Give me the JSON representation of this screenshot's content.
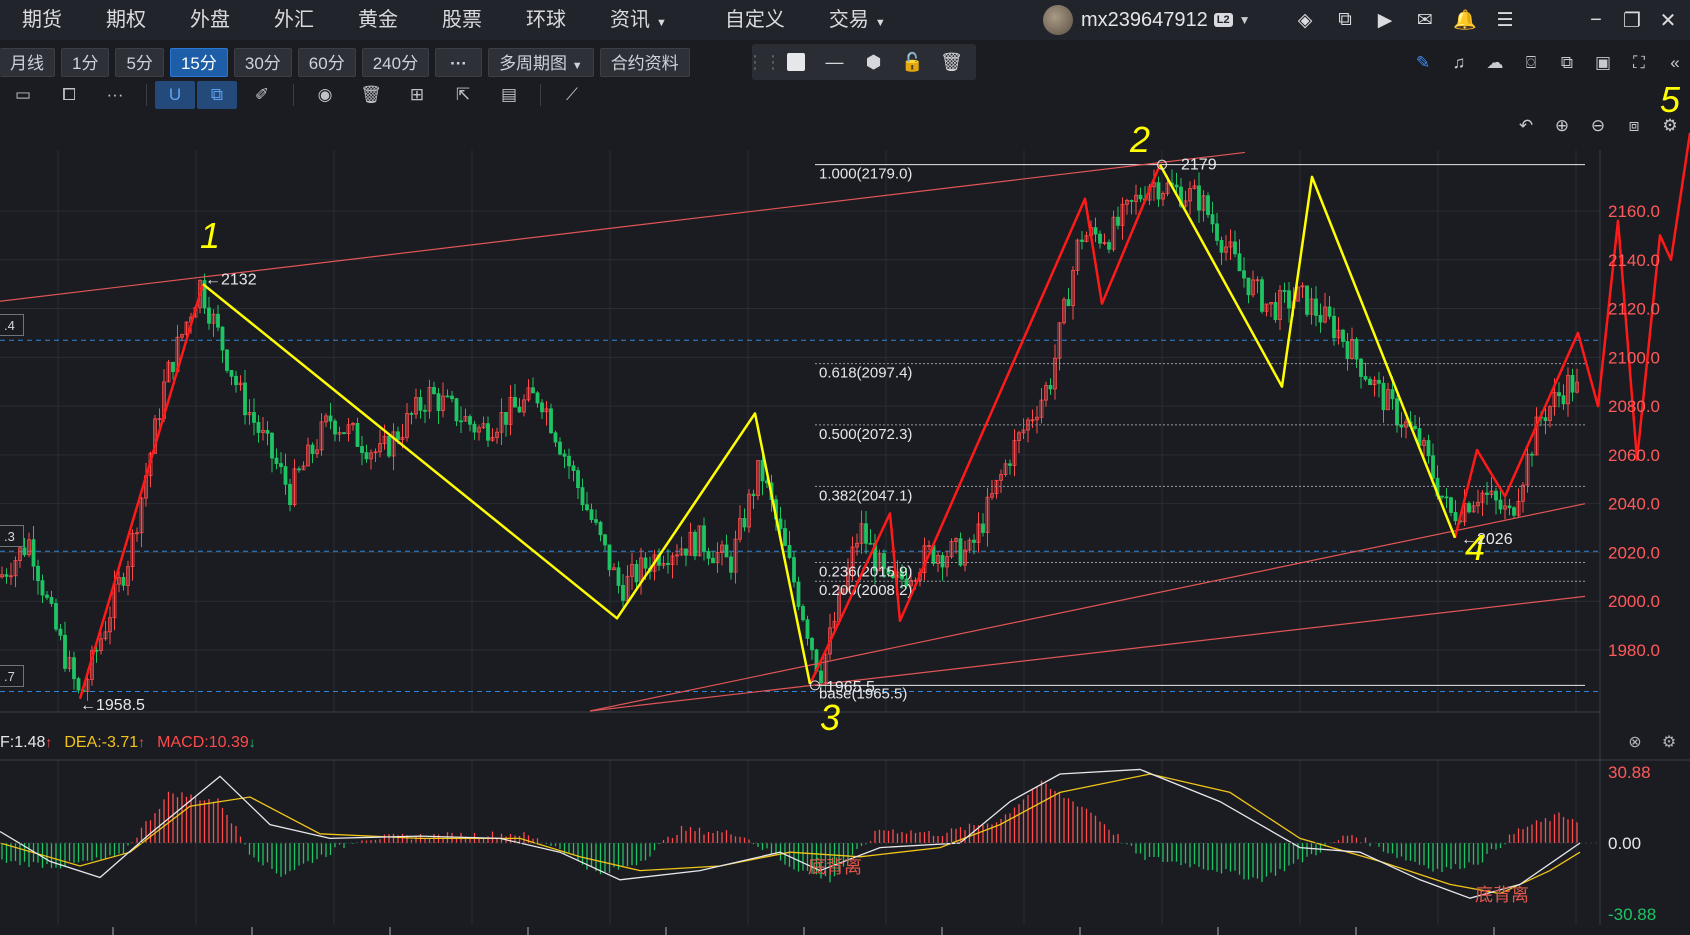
{
  "top_nav": {
    "items": [
      {
        "label": "期货",
        "dropdown": false
      },
      {
        "label": "期权",
        "dropdown": false
      },
      {
        "label": "外盘",
        "dropdown": false
      },
      {
        "label": "外汇",
        "dropdown": false
      },
      {
        "label": "黄金",
        "dropdown": false
      },
      {
        "label": "股票",
        "dropdown": false
      },
      {
        "label": "环球",
        "dropdown": false
      },
      {
        "label": "资讯",
        "dropdown": true
      },
      {
        "label": "自定义",
        "dropdown": false
      },
      {
        "label": "交易",
        "dropdown": true
      }
    ]
  },
  "user": {
    "name": "mx239647912",
    "badge": "L2"
  },
  "top_icons": [
    "layers-icon",
    "expand-window-icon",
    "video-icon",
    "mail-icon",
    "bell-icon",
    "menu-list-icon"
  ],
  "window_buttons": {
    "minimize": "−",
    "restore": "❐",
    "close": "✕"
  },
  "period_toolbar": {
    "buttons": [
      "月线",
      "1分",
      "5分",
      "15分",
      "30分",
      "60分",
      "240分",
      "···",
      "多周期图",
      "合约资料"
    ],
    "active": "15分"
  },
  "draw_toolbar": [
    "grip-icon",
    "square-icon",
    "line-icon",
    "hexagon-icon",
    "unlock-icon",
    "trash-icon"
  ],
  "right_toolbar": [
    "pen-icon",
    "alert-icon",
    "cloud-icon",
    "camera-icon",
    "copy-icon",
    "monitor-icon",
    "fullscreen-icon",
    "collapse-icon"
  ],
  "secondary_toolbar": [
    "comment-icon",
    "crop-icon",
    "more-icon",
    "magnet-icon",
    "overlap-icon",
    "pencil-icon",
    "eye-icon",
    "delete-icon",
    "grid-icon",
    "share-icon",
    "note-icon",
    "ruler-icon"
  ],
  "chart_controls": [
    "undo-icon",
    "zoom-in-icon",
    "zoom-out-icon",
    "fit-icon",
    "settings-icon"
  ],
  "colors": {
    "background": "#1b1c21",
    "up_candle": "#ff4b4b",
    "down_candle": "#1ec463",
    "wave_red": "#ff1a1a",
    "wave_yellow": "#ffff00",
    "trend_line": "#e05555",
    "dashed_blue": "#2f86d6",
    "axis_text": "#ff5a5a"
  },
  "price_axis_labels": [
    "2160.0",
    "2140.0",
    "2120.0",
    "2100.0",
    "2080.0",
    "2060.0",
    "2040.0",
    "2020.0",
    "2000.0",
    "1980.0"
  ],
  "left_edge_labels": [
    ".4",
    ".3",
    ".7"
  ],
  "fib_labels": [
    "1.000(2179.0)",
    "0.618(2097.4)",
    "0.500(2072.3)",
    "0.382(2047.1)",
    "0.236(2015.9)",
    "0.200(2008.2)",
    "base(1965.5)"
  ],
  "price_markers": [
    "←2132",
    "2179",
    "←2026",
    "←1958.5",
    "1965.5"
  ],
  "wave_labels": [
    "1",
    "2",
    "3",
    "4",
    "5"
  ],
  "macd_legend": {
    "dif": "F:1.48",
    "dea": "DEA:-3.71",
    "macd": "MACD:10.39"
  },
  "macd_axis_labels": [
    "30.88",
    "0.00",
    "-30.88"
  ],
  "macd_annotations": [
    "底背离",
    "底背离"
  ],
  "chart_data": {
    "type": "candlestick",
    "instrument_period": "15分",
    "price_axis": {
      "min": 1960,
      "max": 2180,
      "ticks": [
        1980,
        2000,
        2020,
        2040,
        2060,
        2080,
        2100,
        2120,
        2140,
        2160
      ]
    },
    "fibonacci": [
      {
        "level": "1.000",
        "price": 2179.0
      },
      {
        "level": "0.618",
        "price": 2097.4
      },
      {
        "level": "0.500",
        "price": 2072.3
      },
      {
        "level": "0.382",
        "price": 2047.1
      },
      {
        "level": "0.236",
        "price": 2015.9
      },
      {
        "level": "0.200",
        "price": 2008.2
      },
      {
        "level": "base",
        "price": 1965.5
      }
    ],
    "marked_prices": {
      "high_2132": 2132,
      "high_2179": 2179,
      "low_2026": 2026,
      "low_1958_5": 1958.5,
      "low_1965_5": 1965.5
    },
    "macd": {
      "dif": 1.48,
      "dea": -3.71,
      "macd": 10.39,
      "axis": [
        -30.88,
        0.0,
        30.88
      ]
    }
  }
}
